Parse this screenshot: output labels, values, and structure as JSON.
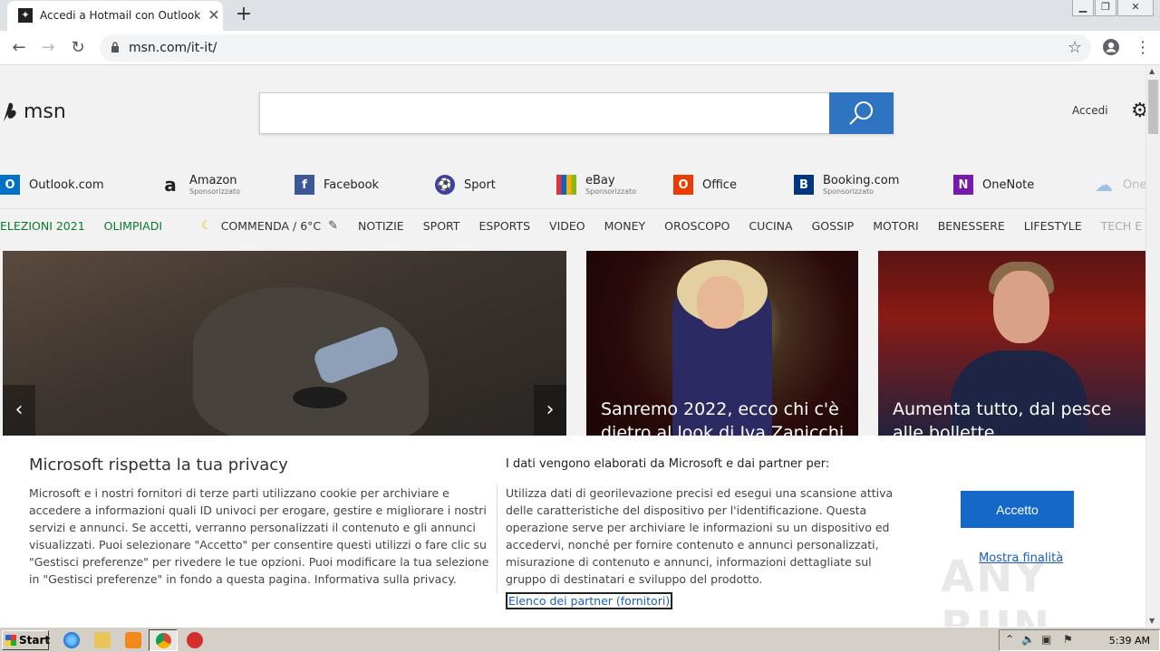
{
  "browser": {
    "tab_title": "Accedi a Hotmail con Outlook, leggi l",
    "url": "msn.com/it-it/"
  },
  "header": {
    "logo_text": "msn",
    "signin": "Accedi"
  },
  "quicklinks": [
    {
      "label": "Outlook.com",
      "sub": "",
      "icon": "outlook-icon",
      "color": "#0072c6"
    },
    {
      "label": "Amazon",
      "sub": "Sponsorizzato",
      "icon": "amazon-icon",
      "color": "#222222"
    },
    {
      "label": "Facebook",
      "sub": "",
      "icon": "facebook-icon",
      "color": "#3b5998"
    },
    {
      "label": "Sport",
      "sub": "",
      "icon": "sport-icon",
      "color": "#3a3fa0"
    },
    {
      "label": "eBay",
      "sub": "Sponsorizzato",
      "icon": "ebay-icon",
      "color": "#e53238"
    },
    {
      "label": "Office",
      "sub": "",
      "icon": "office-icon",
      "color": "#eb3c00"
    },
    {
      "label": "Booking.com",
      "sub": "Sponsorizzato",
      "icon": "booking-icon",
      "color": "#003580"
    },
    {
      "label": "OneNote",
      "sub": "",
      "icon": "onenote-icon",
      "color": "#7719aa"
    },
    {
      "label": "One",
      "sub": "",
      "icon": "onedrive-icon",
      "color": "#9cc3e6"
    }
  ],
  "nav": {
    "elezioni": "ELEZIONI 2021",
    "olimpiadi": "OLIMPIADI",
    "weather": "COMMENDA / 6°C",
    "items": [
      "NOTIZIE",
      "SPORT",
      "ESPORTS",
      "VIDEO",
      "MONEY",
      "OROSCOPO",
      "CUCINA",
      "GOSSIP",
      "MOTORI",
      "BENESSERE",
      "LIFESTYLE",
      "TECH E SC"
    ]
  },
  "stories": [
    {
      "title": "Sanremo 2022, ecco chi c'è dietro al look di Iva Zanicchi"
    },
    {
      "title": "Aumenta tutto, dal pesce alle bollette"
    }
  ],
  "consent": {
    "title": "Microsoft rispetta la tua privacy",
    "body": "Microsoft e i nostri fornitori di terze parti utilizzano cookie per archiviare e accedere a informazioni quali ID univoci per erogare, gestire e migliorare i nostri servizi e annunci. Se accetti, verranno personalizzati il contenuto e gli annunci visualizzati. Puoi selezionare \"Accetto\" per consentire questi utilizzi o fare clic su \"Gestisci preferenze\" per rivedere le tue opzioni. Puoi modificare la tua selezione in \"Gestisci preferenze\" in fondo a questa pagina. Informativa sulla privacy.",
    "subtitle": "I dati vengono elaborati da Microsoft e dai partner per:",
    "body2": "Utilizza dati di georilevazione precisi ed esegui una scansione attiva delle caratteristiche del dispositivo per l'identificazione. Questa operazione serve per archiviare le informazioni su un dispositivo ed accedervi, nonché per fornire contenuto e annunci personalizzati, misurazione di contenuto e annunci, informazioni dettagliate sul gruppo di destinatari e sviluppo del prodotto.",
    "partners_link": "Elenco dei partner (fornitori)",
    "accept": "Accetto",
    "show_purposes": "Mostra finalità"
  },
  "watermark": "ANY RUN",
  "taskbar": {
    "start": "Start",
    "clock": "5:39 AM"
  }
}
